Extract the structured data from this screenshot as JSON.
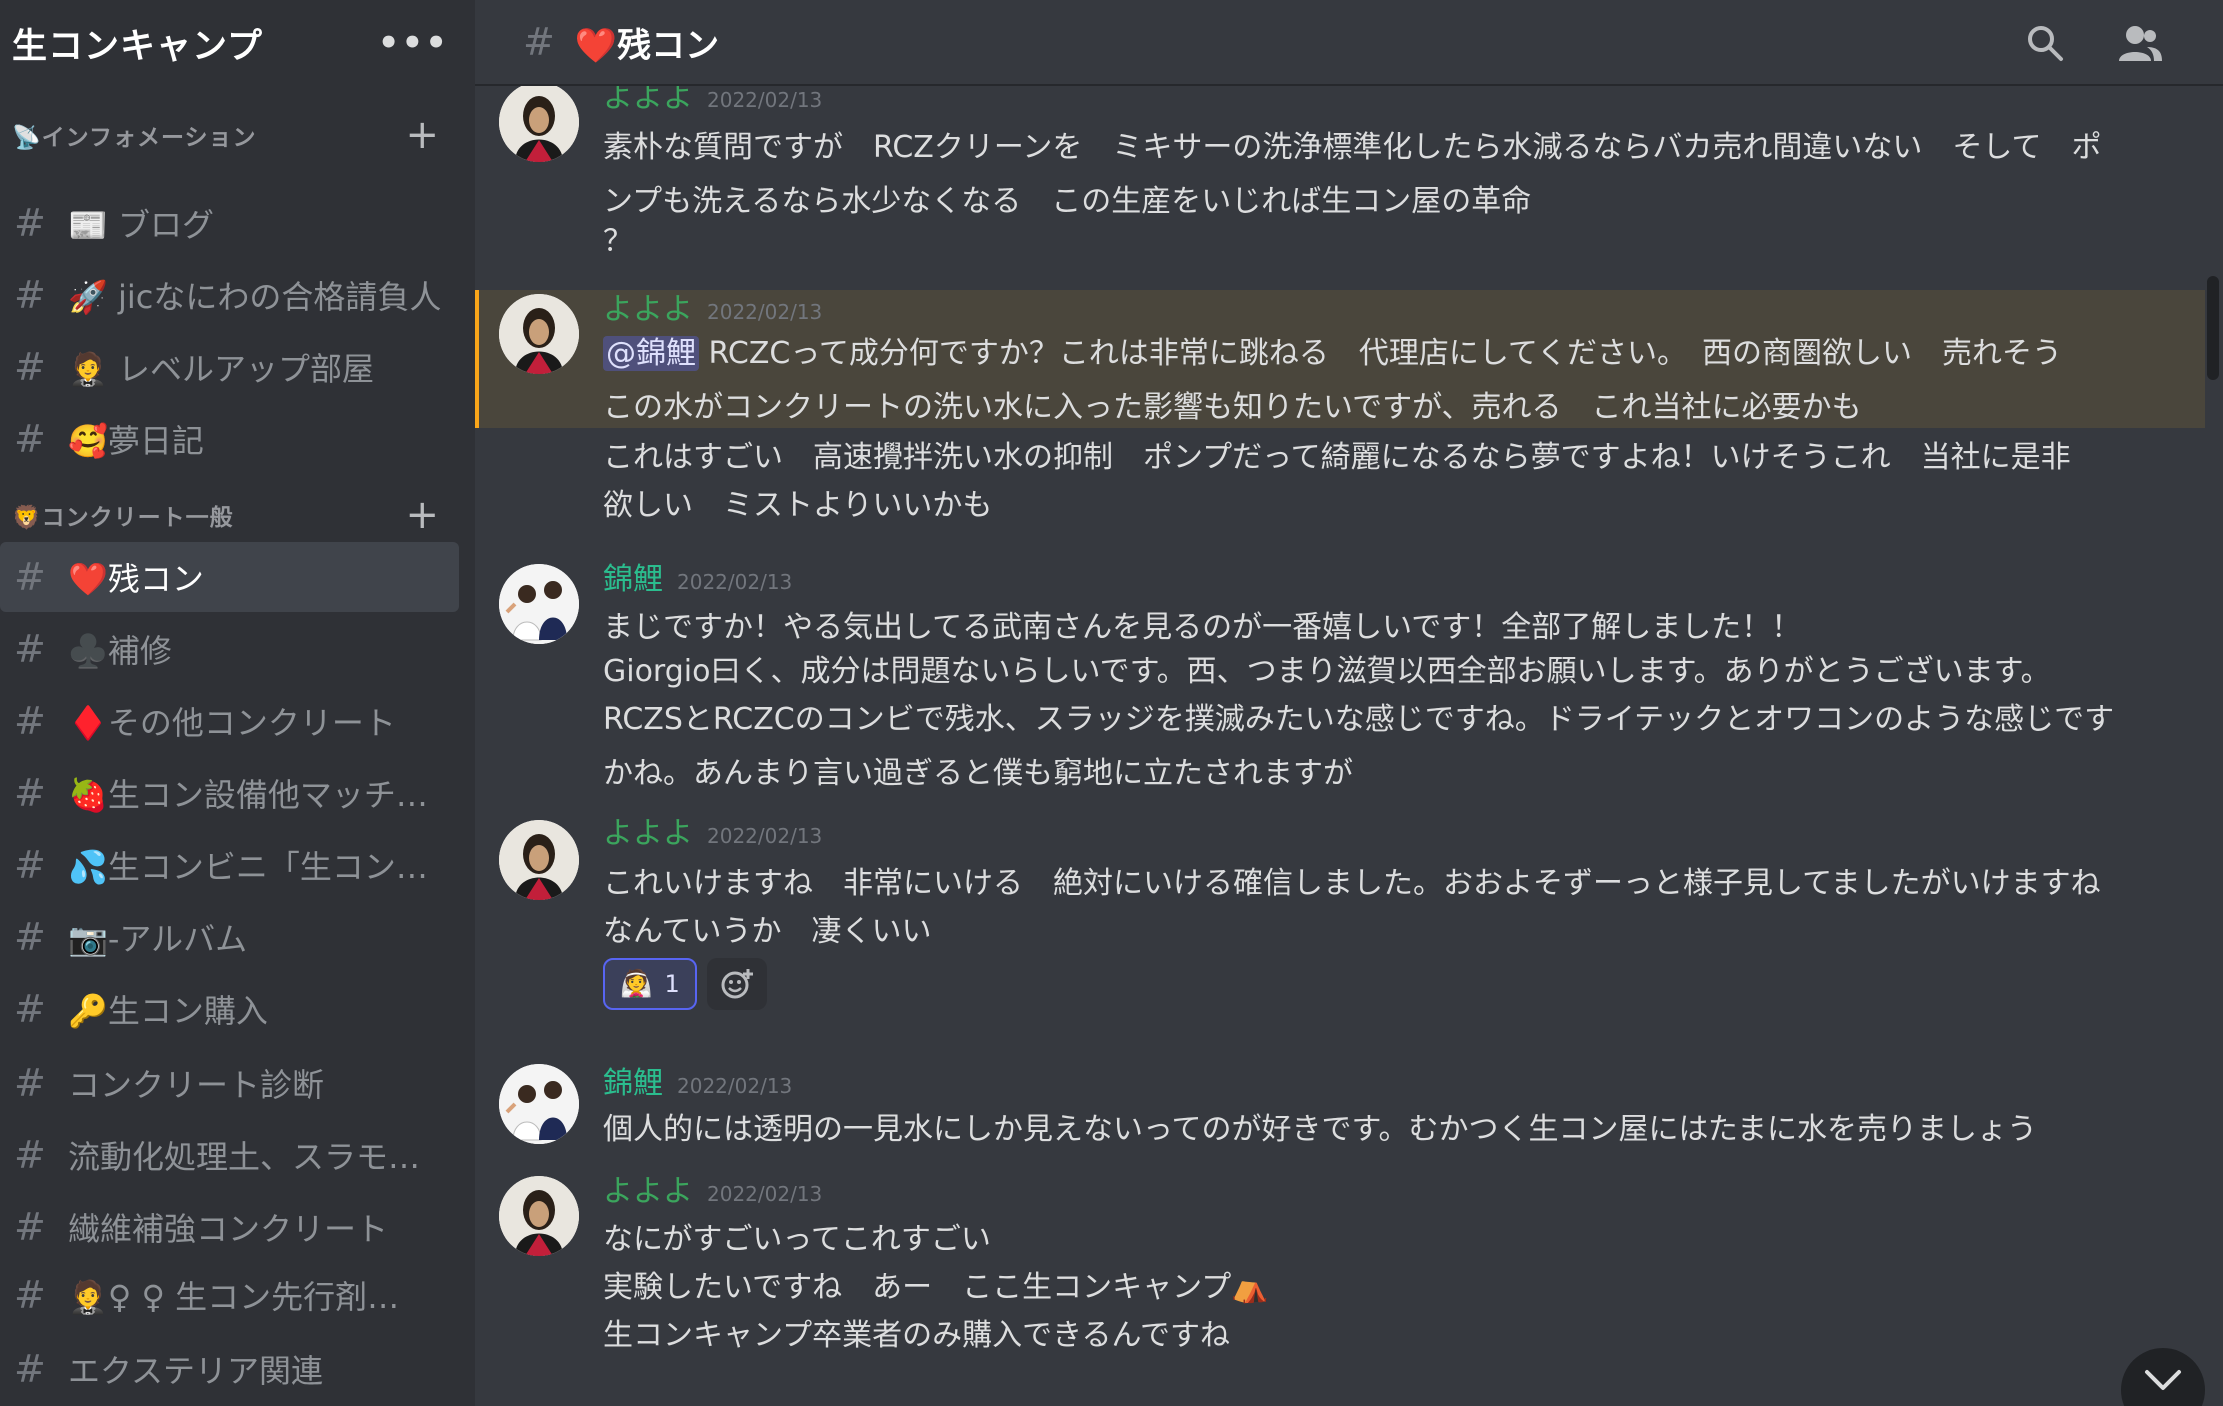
{
  "server": {
    "name": "生コンキャンプ",
    "menu": "•••"
  },
  "categories": {
    "info": {
      "label": "📡インフォメーション",
      "add": "+"
    },
    "general": {
      "label": "🦁コンクリート一般",
      "add": "+"
    }
  },
  "channels": [
    {
      "hash": "#",
      "label": "📰 ブログ"
    },
    {
      "hash": "#",
      "label": "🚀 jicなにわの合格請負人"
    },
    {
      "hash": "#",
      "label": "🤵 レベルアップ部屋"
    },
    {
      "hash": "#",
      "label": "🥰夢日記"
    },
    {
      "hash": "#",
      "label": "❤️残コン",
      "active": true
    },
    {
      "hash": "#",
      "label": "♣️補修"
    },
    {
      "hash": "#",
      "label": "♦️その他コンクリート"
    },
    {
      "hash": "#",
      "label": "🍓生コン設備他マッチ…"
    },
    {
      "hash": "#",
      "label": "💦生コンビニ「生コン…"
    },
    {
      "hash": "#",
      "label": "📷-アルバム"
    },
    {
      "hash": "#",
      "label": "🔑生コン購入"
    },
    {
      "hash": "#",
      "label": "コンクリート診断"
    },
    {
      "hash": "#",
      "label": "流動化処理土、スラモ…"
    },
    {
      "hash": "#",
      "label": "繊維補強コンクリート"
    },
    {
      "hash": "#",
      "label": "🤵♀ ♀ 生コン先行剤…"
    },
    {
      "hash": "#",
      "label": "エクステリア関連"
    }
  ],
  "topbar": {
    "hash": "#",
    "title": "❤️残コン",
    "icons": [
      "search-icon",
      "members-icon"
    ]
  },
  "messages": [
    {
      "author": "よよよ",
      "time": "2022/02/13",
      "lines": [
        "素朴な質問ですが　RCZクリーンを　ミキサーの洗浄標準化したら水減るならバカ売れ間違いない　そして　ポ",
        "ンプも洗えるなら水少なくなる　この生産をいじれば生コン屋の革命",
        "？"
      ]
    },
    {
      "author": "よよよ",
      "time": "2022/02/13",
      "highlighted": true,
      "mention": "@錦鯉",
      "lines": [
        " RCZCって成分何ですか？これは非常に跳ねる　代理店にしてください。　西の商圏欲しい　売れそう",
        "この水がコンクリートの洗い水に入った影響も知りたいですが、売れる　これ当社に必要かも",
        "これはすごい　高速攪拌洗い水の抑制　ポンプだって綺麗になるなら夢ですよね！いけそうこれ　当社に是非",
        "欲しい　ミストよりいいかも"
      ]
    },
    {
      "author": "錦鯉",
      "time": "2022/02/13",
      "lines": [
        "まじですか！やる気出してる武南さんを見るのが一番嬉しいです！全部了解しました！！",
        "Giorgio曰く、成分は問題ないらしいです。西、つまり滋賀以西全部お願いします。ありがとうございます。",
        "RCZSとRCZCのコンビで残水、スラッジを撲滅みたいな感じですね。ドライテックとオワコンのような感じです",
        "かね。あんまり言い過ぎると僕も窮地に立たされますが"
      ]
    },
    {
      "author": "よよよ",
      "time": "2022/02/13",
      "lines": [
        "これいけますね　非常にいける　絶対にいける確信しました。おおよそずーっと様子見してましたがいけますね",
        "なんていうか　凄くいい"
      ],
      "reaction": {
        "emoji": "👰",
        "count": "1"
      }
    },
    {
      "author": "錦鯉",
      "time": "2022/02/13",
      "lines": [
        "個人的には透明の一見水にしか見えないってのが好きです。むかつく生コン屋にはたまに水を売りましょう"
      ]
    },
    {
      "author": "よよよ",
      "time": "2022/02/13",
      "lines": [
        "なにがすごいってこれすごい",
        "実験したいですね　あー　ここ生コンキャンプ⛺",
        "生コンキャンプ卒業者のみ購入できるんですね"
      ]
    }
  ]
}
